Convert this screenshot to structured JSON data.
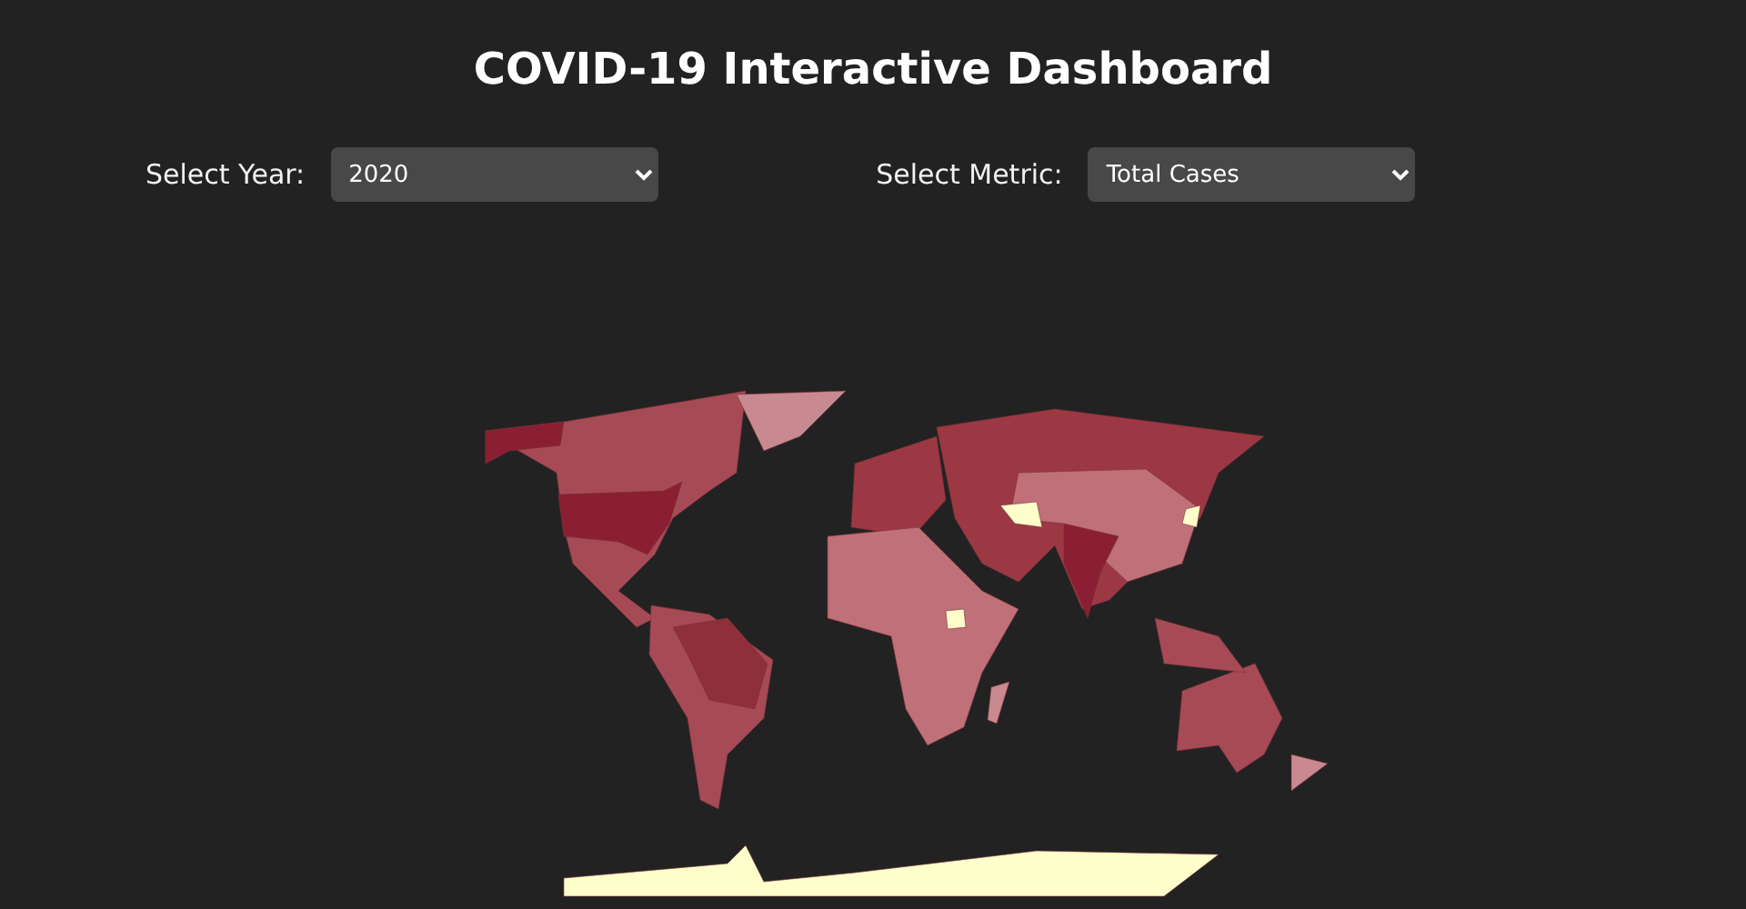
{
  "title": "COVID-19 Interactive Dashboard",
  "controls": [
    {
      "label": "Select Year:",
      "value": "2020"
    },
    {
      "label": "Select Metric:",
      "value": "Total Cases"
    }
  ]
}
